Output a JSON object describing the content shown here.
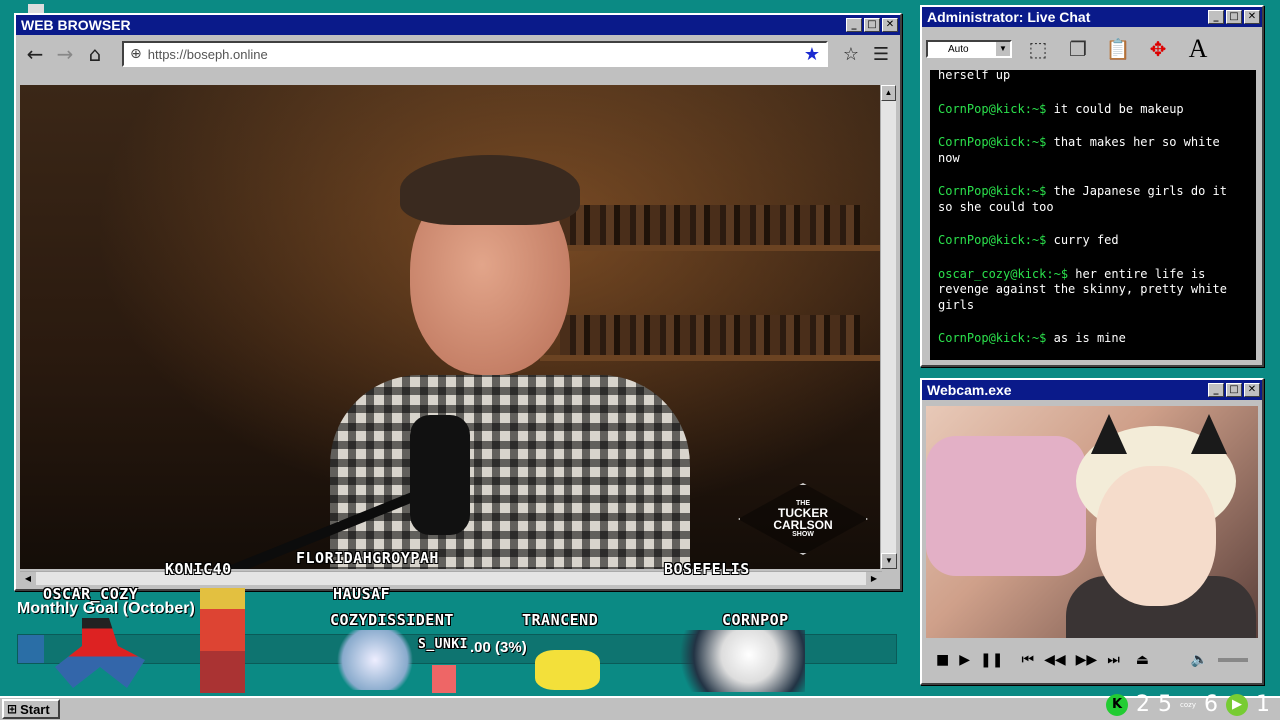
{
  "browser": {
    "title": "WEB BROWSER",
    "url": "https://boseph.online",
    "show_logo": {
      "line1": "THE",
      "line2": "TUCKER",
      "line3": "CARLSON",
      "line4": "SHOW"
    }
  },
  "chat": {
    "title": "Administrator: Live Chat",
    "zoom": "Auto",
    "partial_top": "herself up",
    "messages": [
      {
        "user": "CornPop@kick:~$",
        "text": "it could be makeup"
      },
      {
        "user": "CornPop@kick:~$",
        "text": "that makes her so white now"
      },
      {
        "user": "CornPop@kick:~$",
        "text": "the Japanese girls do it so she could too"
      },
      {
        "user": "CornPop@kick:~$",
        "text": "curry fed"
      },
      {
        "user": "oscar_cozy@kick:~$",
        "text": "her entire life is revenge against the skinny, pretty white girls"
      },
      {
        "user": "CornPop@kick:~$",
        "text": "as is mine"
      }
    ]
  },
  "webcam": {
    "title": "Webcam.exe"
  },
  "overlay": {
    "usernames": [
      "KONIC40",
      "FLORIDAHGROYPAH",
      "BOSEFELIS",
      "OSCAR_COZY",
      "HAUSAF",
      "COZYDISSIDENT",
      "TRANCEND",
      "CORNPOP"
    ],
    "goal_label": "Monthly Goal (October)",
    "goal_text": ".00 (3%)",
    "goal_fraction": 0.03,
    "goal_partial": "S_UNKI"
  },
  "taskbar": {
    "start_label": "Start",
    "tray_count_a": "2",
    "tray_count_b": "5",
    "tray_small": "cozy",
    "tray_count_c": "6",
    "tray_count_d": "1"
  },
  "colors": {
    "title_blue": "#0a1a8a",
    "desktop": "#0b8a84",
    "chat_user": "#2be04c"
  }
}
